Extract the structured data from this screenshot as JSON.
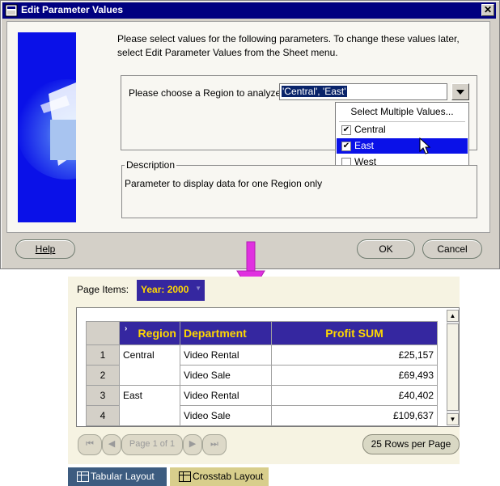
{
  "dialog": {
    "title": "Edit Parameter Values",
    "intro_line1": "Please select values for the following parameters.  To change these values later,",
    "intro_line2": "select Edit Parameter Values from the Sheet menu.",
    "region_label": "Please choose a Region to analyze",
    "region_value": "'Central', 'East'",
    "dropdown": {
      "header": "Select Multiple Values...",
      "options": [
        {
          "label": "Central",
          "checked": true,
          "selected": false
        },
        {
          "label": "East",
          "checked": true,
          "selected": true
        },
        {
          "label": "West",
          "checked": false,
          "selected": false
        }
      ]
    },
    "description_legend": "Description",
    "description_text": "Parameter to display data for one Region only",
    "help_label": "Help",
    "ok_label": "OK",
    "cancel_label": "Cancel"
  },
  "report": {
    "page_items_label": "Page Items:",
    "year_select": "Year: 2000",
    "table": {
      "headers": [
        "Region",
        "Department",
        "Profit SUM"
      ],
      "rows": [
        {
          "num": "1",
          "region": "Central",
          "department": "Video Rental",
          "profit": "£25,157"
        },
        {
          "num": "2",
          "region": "",
          "department": "Video Sale",
          "profit": "£69,493"
        },
        {
          "num": "3",
          "region": "East",
          "department": "Video Rental",
          "profit": "£40,402"
        },
        {
          "num": "4",
          "region": "",
          "department": "Video Sale",
          "profit": "£109,637"
        }
      ]
    },
    "pager_label": "Page 1 of 1",
    "rows_per_page": "25 Rows per Page",
    "tabs": [
      "Tabular Layout",
      "Crosstab Layout"
    ]
  },
  "colors": {
    "title_bar": "#000080",
    "header_bg": "#3527a0",
    "header_text": "#ffd800",
    "arrow": "#e030e0",
    "graphic_blue": "#0a11e8"
  }
}
